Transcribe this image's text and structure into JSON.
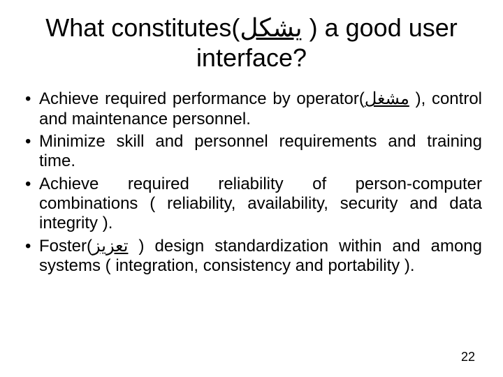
{
  "title": {
    "pre": "What constitutes(",
    "arabic": "يشكل",
    "post": " ) a good user interface?"
  },
  "bullets": [
    {
      "pre": "Achieve required performance by operator(",
      "arabic": "مشغل",
      "post": " ), control and maintenance personnel."
    },
    {
      "pre": "Minimize skill and personnel requirements and training time.",
      "arabic": "",
      "post": ""
    },
    {
      "pre": "Achieve required reliability of person-computer combinations ( reliability, availability, security and data integrity ).",
      "arabic": "",
      "post": ""
    },
    {
      "pre": "Foster(",
      "arabic": "تعزيز",
      "post": " ) design standardization within and among systems ( integration, consistency and portability )."
    }
  ],
  "page_number": "22"
}
